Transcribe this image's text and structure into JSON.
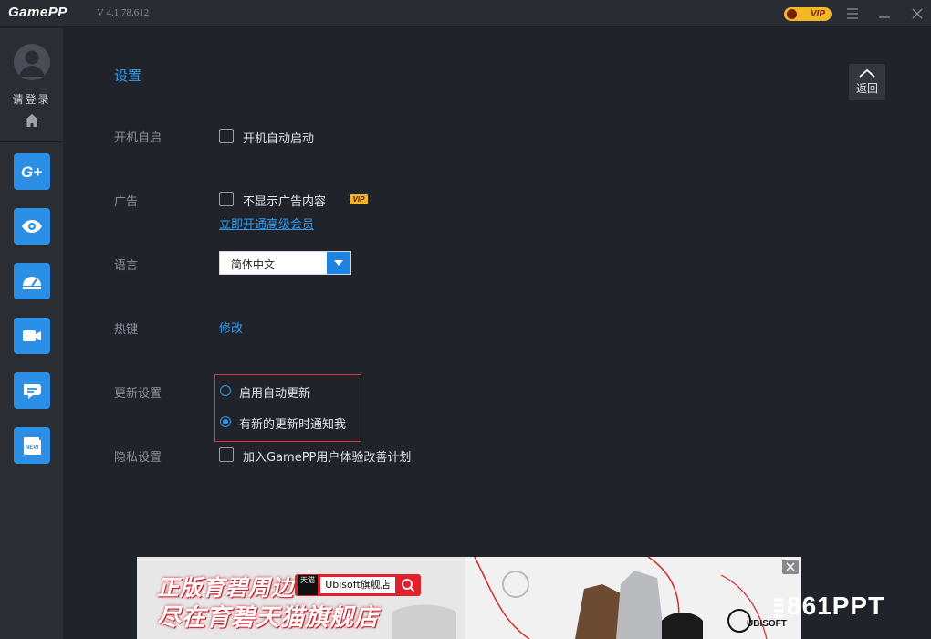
{
  "titlebar": {
    "logo": "GamePP",
    "version": "V 4.1.78.612",
    "vip_badge": "VIP"
  },
  "sidebar": {
    "login_label": "请登录",
    "items": [
      {
        "name": "g-plus",
        "label": "G+"
      },
      {
        "name": "eye"
      },
      {
        "name": "speedometer"
      },
      {
        "name": "video-camera"
      },
      {
        "name": "chat"
      },
      {
        "name": "news",
        "label": "NEW"
      }
    ]
  },
  "main": {
    "title": "设置",
    "back_label": "返回",
    "rows": {
      "startup": {
        "label": "开机自启",
        "option": "开机自动启动",
        "checked": false
      },
      "ads": {
        "label": "广告",
        "option": "不显示广告内容",
        "checked": false,
        "vip_tag": "VIP",
        "link": "立即开通高级会员"
      },
      "language": {
        "label": "语言",
        "selected": "简体中文"
      },
      "hotkey": {
        "label": "热键",
        "link": "修改"
      },
      "update": {
        "label": "更新设置",
        "options": [
          "启用自动更新",
          "有新的更新时通知我"
        ],
        "selected_index": 1
      },
      "privacy": {
        "label": "隐私设置",
        "option": "加入GamePP用户体验改善计划",
        "checked": false
      }
    }
  },
  "ad": {
    "line1": "正版育碧周边",
    "line2": "尽在育碧天猫旗舰店",
    "store_tmall": "天猫",
    "store_label": "Ubisoft旗舰店",
    "brand": "UBISOFT"
  },
  "watermark": "861PPT",
  "colors": {
    "accent": "#2d9cf0",
    "nav_button": "#2b8fe6",
    "highlight_border": "#e0323a",
    "vip_gold": "#f2b827"
  }
}
